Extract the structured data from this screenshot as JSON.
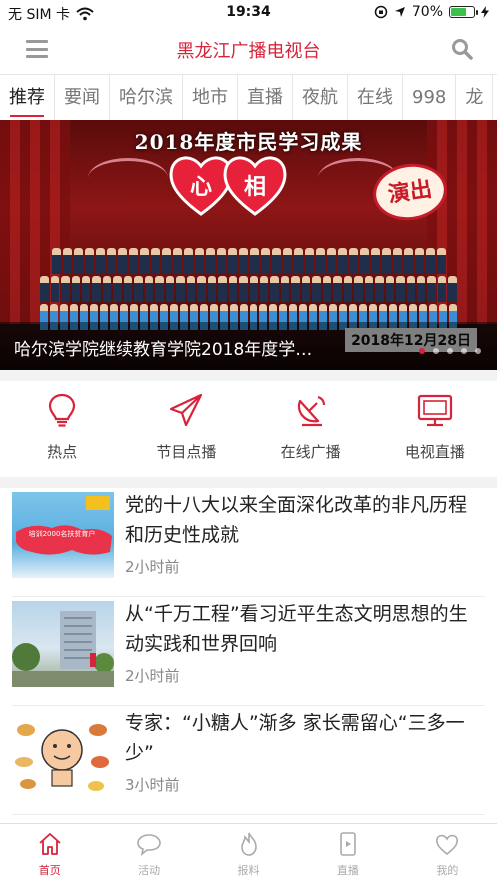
{
  "status_bar": {
    "carrier": "无 SIM 卡",
    "time": "19:34",
    "battery": "70%",
    "battery_level": 0.7
  },
  "header": {
    "title": "黑龙江广播电视台",
    "menu_icon": "menu-icon",
    "search_icon": "search-icon"
  },
  "tabs": [
    {
      "label": "推荐",
      "active": true
    },
    {
      "label": "要闻"
    },
    {
      "label": "哈尔滨"
    },
    {
      "label": "地市"
    },
    {
      "label": "直播"
    },
    {
      "label": "夜航"
    },
    {
      "label": "在线"
    },
    {
      "label": "998"
    },
    {
      "label": "龙"
    }
  ],
  "banner": {
    "headline": "2018年度市民学习成果",
    "stamp": "演出",
    "hearts": [
      "心",
      "相"
    ],
    "date_sign": "2018年12月28日",
    "caption": "哈尔滨学院继续教育学院2018年度学…",
    "slide_count": 5,
    "active_slide": 0
  },
  "quick_entries": [
    {
      "label": "热点",
      "icon": "bulb-icon"
    },
    {
      "label": "节目点播",
      "icon": "paper-plane-icon"
    },
    {
      "label": "在线广播",
      "icon": "satellite-dish-icon"
    },
    {
      "label": "电视直播",
      "icon": "tv-icon"
    }
  ],
  "news": [
    {
      "title": "党的十八大以来全面深化改革的非凡历程和历史性成就",
      "time": "2小时前",
      "thumb_caption": "培训2000名扶贫育户"
    },
    {
      "title": "从“千万工程”看习近平生态文明思想的生动实践和世界回响",
      "time": "2小时前"
    },
    {
      "title": "专家：“小糖人”渐多 家长需留心“三多一少”",
      "time": "3小时前"
    }
  ],
  "tabbar": [
    {
      "label": "首页",
      "icon": "home-icon",
      "active": true
    },
    {
      "label": "活动",
      "icon": "chat-bubble-icon"
    },
    {
      "label": "报料",
      "icon": "flame-icon"
    },
    {
      "label": "直播",
      "icon": "phone-play-icon"
    },
    {
      "label": "我的",
      "icon": "heart-icon"
    }
  ],
  "colors": {
    "accent": "#d6243a",
    "inactive": "#aaaaaa"
  }
}
